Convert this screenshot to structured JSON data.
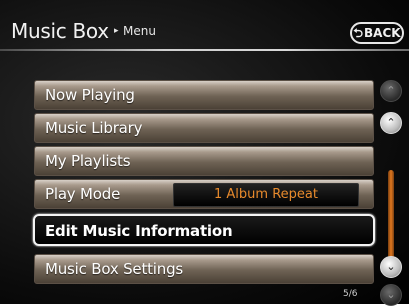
{
  "header": {
    "title": "Music Box",
    "breadcrumb_arrow": "▸",
    "breadcrumb": "Menu",
    "back_arrow": "⮌",
    "back_label": "BACK"
  },
  "menu": {
    "items": [
      {
        "label": "Now Playing"
      },
      {
        "label": "Music Library"
      },
      {
        "label": "My Playlists"
      },
      {
        "label": "Play Mode",
        "value": "1 Album Repeat"
      },
      {
        "label": "Edit Music Information",
        "selected": true
      },
      {
        "label": "Music Box Settings"
      }
    ]
  },
  "scroll": {
    "up_icon": "⌃",
    "down_icon": "⌄",
    "accent_color": "#e0781e"
  },
  "page_indicator": "5/6",
  "colors": {
    "value_text": "#e88a2c",
    "row_gradient_top": "#d8d0c8",
    "selected_border": "#f4f4f4"
  }
}
